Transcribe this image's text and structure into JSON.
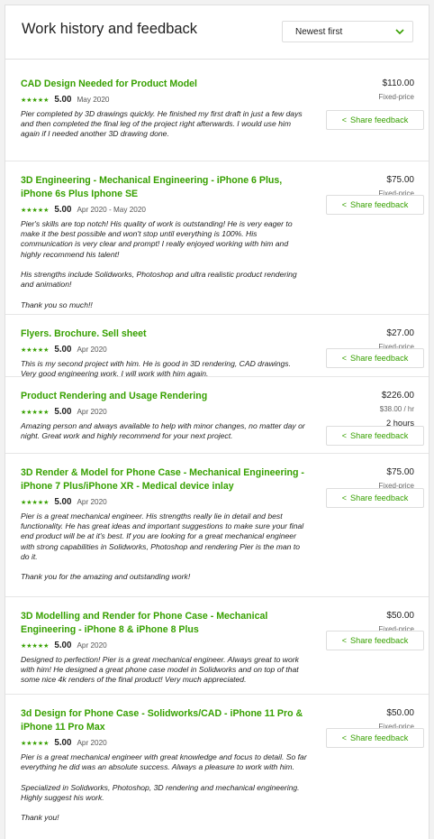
{
  "header": {
    "title": "Work history and feedback",
    "sort_value": "Newest first"
  },
  "share_label": "Share feedback",
  "colors": {
    "accent": "#37a000"
  },
  "items": [
    {
      "title": "CAD Design Needed for Product Model",
      "rating": "5.00",
      "date": "May 2020",
      "feedback": "Pier completed by 3D drawings quickly. He finished my first draft in just a few days and then completed the final leg of the project right afterwards. I would use him again if I needed another 3D drawing done.",
      "price": "$110.00",
      "price_type": "Fixed-price"
    },
    {
      "title": "3D Engineering - Mechanical Engineering - iPhone 6 Plus, iPhone 6s Plus Iphone SE",
      "rating": "5.00",
      "date": "Apr 2020 - May 2020",
      "feedback": "Pier's skills are top notch! His quality of work is outstanding! He is very eager to make it the best possible and won't stop until everything is 100%. His communication is very clear and prompt! I really enjoyed working with him and highly recommend his talent!\n\nHis strengths include Solidworks, Photoshop and ultra realistic product rendering and animation!\n\nThank you so much!!",
      "price": "$75.00",
      "price_type": "Fixed-price"
    },
    {
      "title": "Flyers. Brochure. Sell sheet",
      "rating": "5.00",
      "date": "Apr 2020",
      "feedback": "This is my second project with him. He is good in 3D rendering, CAD drawings. Very good engineering work. I will work with him again.",
      "price": "$27.00",
      "price_type": "Fixed-price"
    },
    {
      "title": "Product Rendering and Usage Rendering",
      "rating": "5.00",
      "date": "Apr 2020",
      "feedback": "Amazing person and always available to help with minor changes, no matter day or night. Great work and highly recommend for your next project.",
      "price": "$226.00",
      "price_type": "$38.00 / hr",
      "hours": "2 hours"
    },
    {
      "title": "3D Render & Model for Phone Case - Mechanical Engineering - iPhone 7 Plus/iPhone XR - Medical device inlay",
      "rating": "5.00",
      "date": "Apr 2020",
      "feedback": "Pier is a great mechanical engineer. His strengths really lie in detail and best functionality. He has great ideas and important suggestions to make sure your final end product will be at it's best. If you are looking for a great mechanical engineer with strong capabilities in Solidworks, Photoshop and rendering Pier is the man to do it.\n\nThank you for the amazing and outstanding work!",
      "price": "$75.00",
      "price_type": "Fixed-price"
    },
    {
      "title": "3D Modelling and Render for Phone Case - Mechanical Engineering - iPhone 8 & iPhone 8 Plus",
      "rating": "5.00",
      "date": "Apr 2020",
      "feedback": "Designed to perfection! Pier is a great mechanical engineer. Always great to work with him! He designed a great phone case model in Solidworks and on top of that some nice 4k renders of the final product! Very much appreciated.",
      "price": "$50.00",
      "price_type": "Fixed-price"
    },
    {
      "title": "3d Design for Phone Case - Solidworks/CAD - iPhone 11 Pro & iPhone 11 Pro Max",
      "rating": "5.00",
      "date": "Apr 2020",
      "feedback": "Pier is a great mechanical engineer with great knowledge and focus to detail. So far everything he did was an absolute success. Always a pleasure to work with him.\n\nSpecialized in Solidworks, Photoshop, 3D rendering and mechanical engineering.\nHighly suggest his work.\n\nThank you!",
      "price": "$50.00",
      "price_type": "Fixed-price"
    }
  ]
}
